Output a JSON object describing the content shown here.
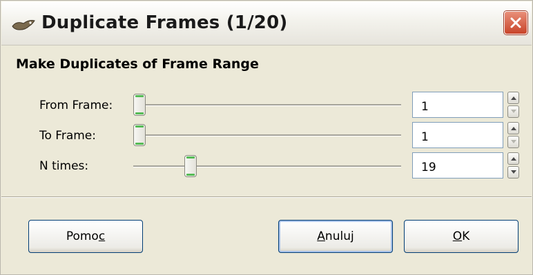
{
  "window": {
    "title": "Duplicate Frames (1/20)",
    "app_icon": "gimp-wilber-icon",
    "close_icon": "close-icon"
  },
  "section": {
    "heading": "Make Duplicates of Frame Range"
  },
  "rows": [
    {
      "label": "From Frame:",
      "value": "1",
      "slider_fraction": 0.0,
      "up_enabled": true,
      "down_enabled": false
    },
    {
      "label": "To Frame:",
      "value": "1",
      "slider_fraction": 0.0,
      "up_enabled": true,
      "down_enabled": false
    },
    {
      "label": "N times:",
      "value": "19",
      "slider_fraction": 0.2,
      "up_enabled": true,
      "down_enabled": true
    }
  ],
  "buttons": {
    "help": {
      "prefix": "Pomo",
      "mnemonic": "c",
      "suffix": ""
    },
    "cancel": {
      "prefix": "",
      "mnemonic": "A",
      "suffix": "nuluj"
    },
    "ok": {
      "prefix": "",
      "mnemonic": "O",
      "suffix": "K"
    }
  },
  "colors": {
    "accent": "#55bb55",
    "close": "#c9452a",
    "dialog_bg": "#ece9d8"
  }
}
